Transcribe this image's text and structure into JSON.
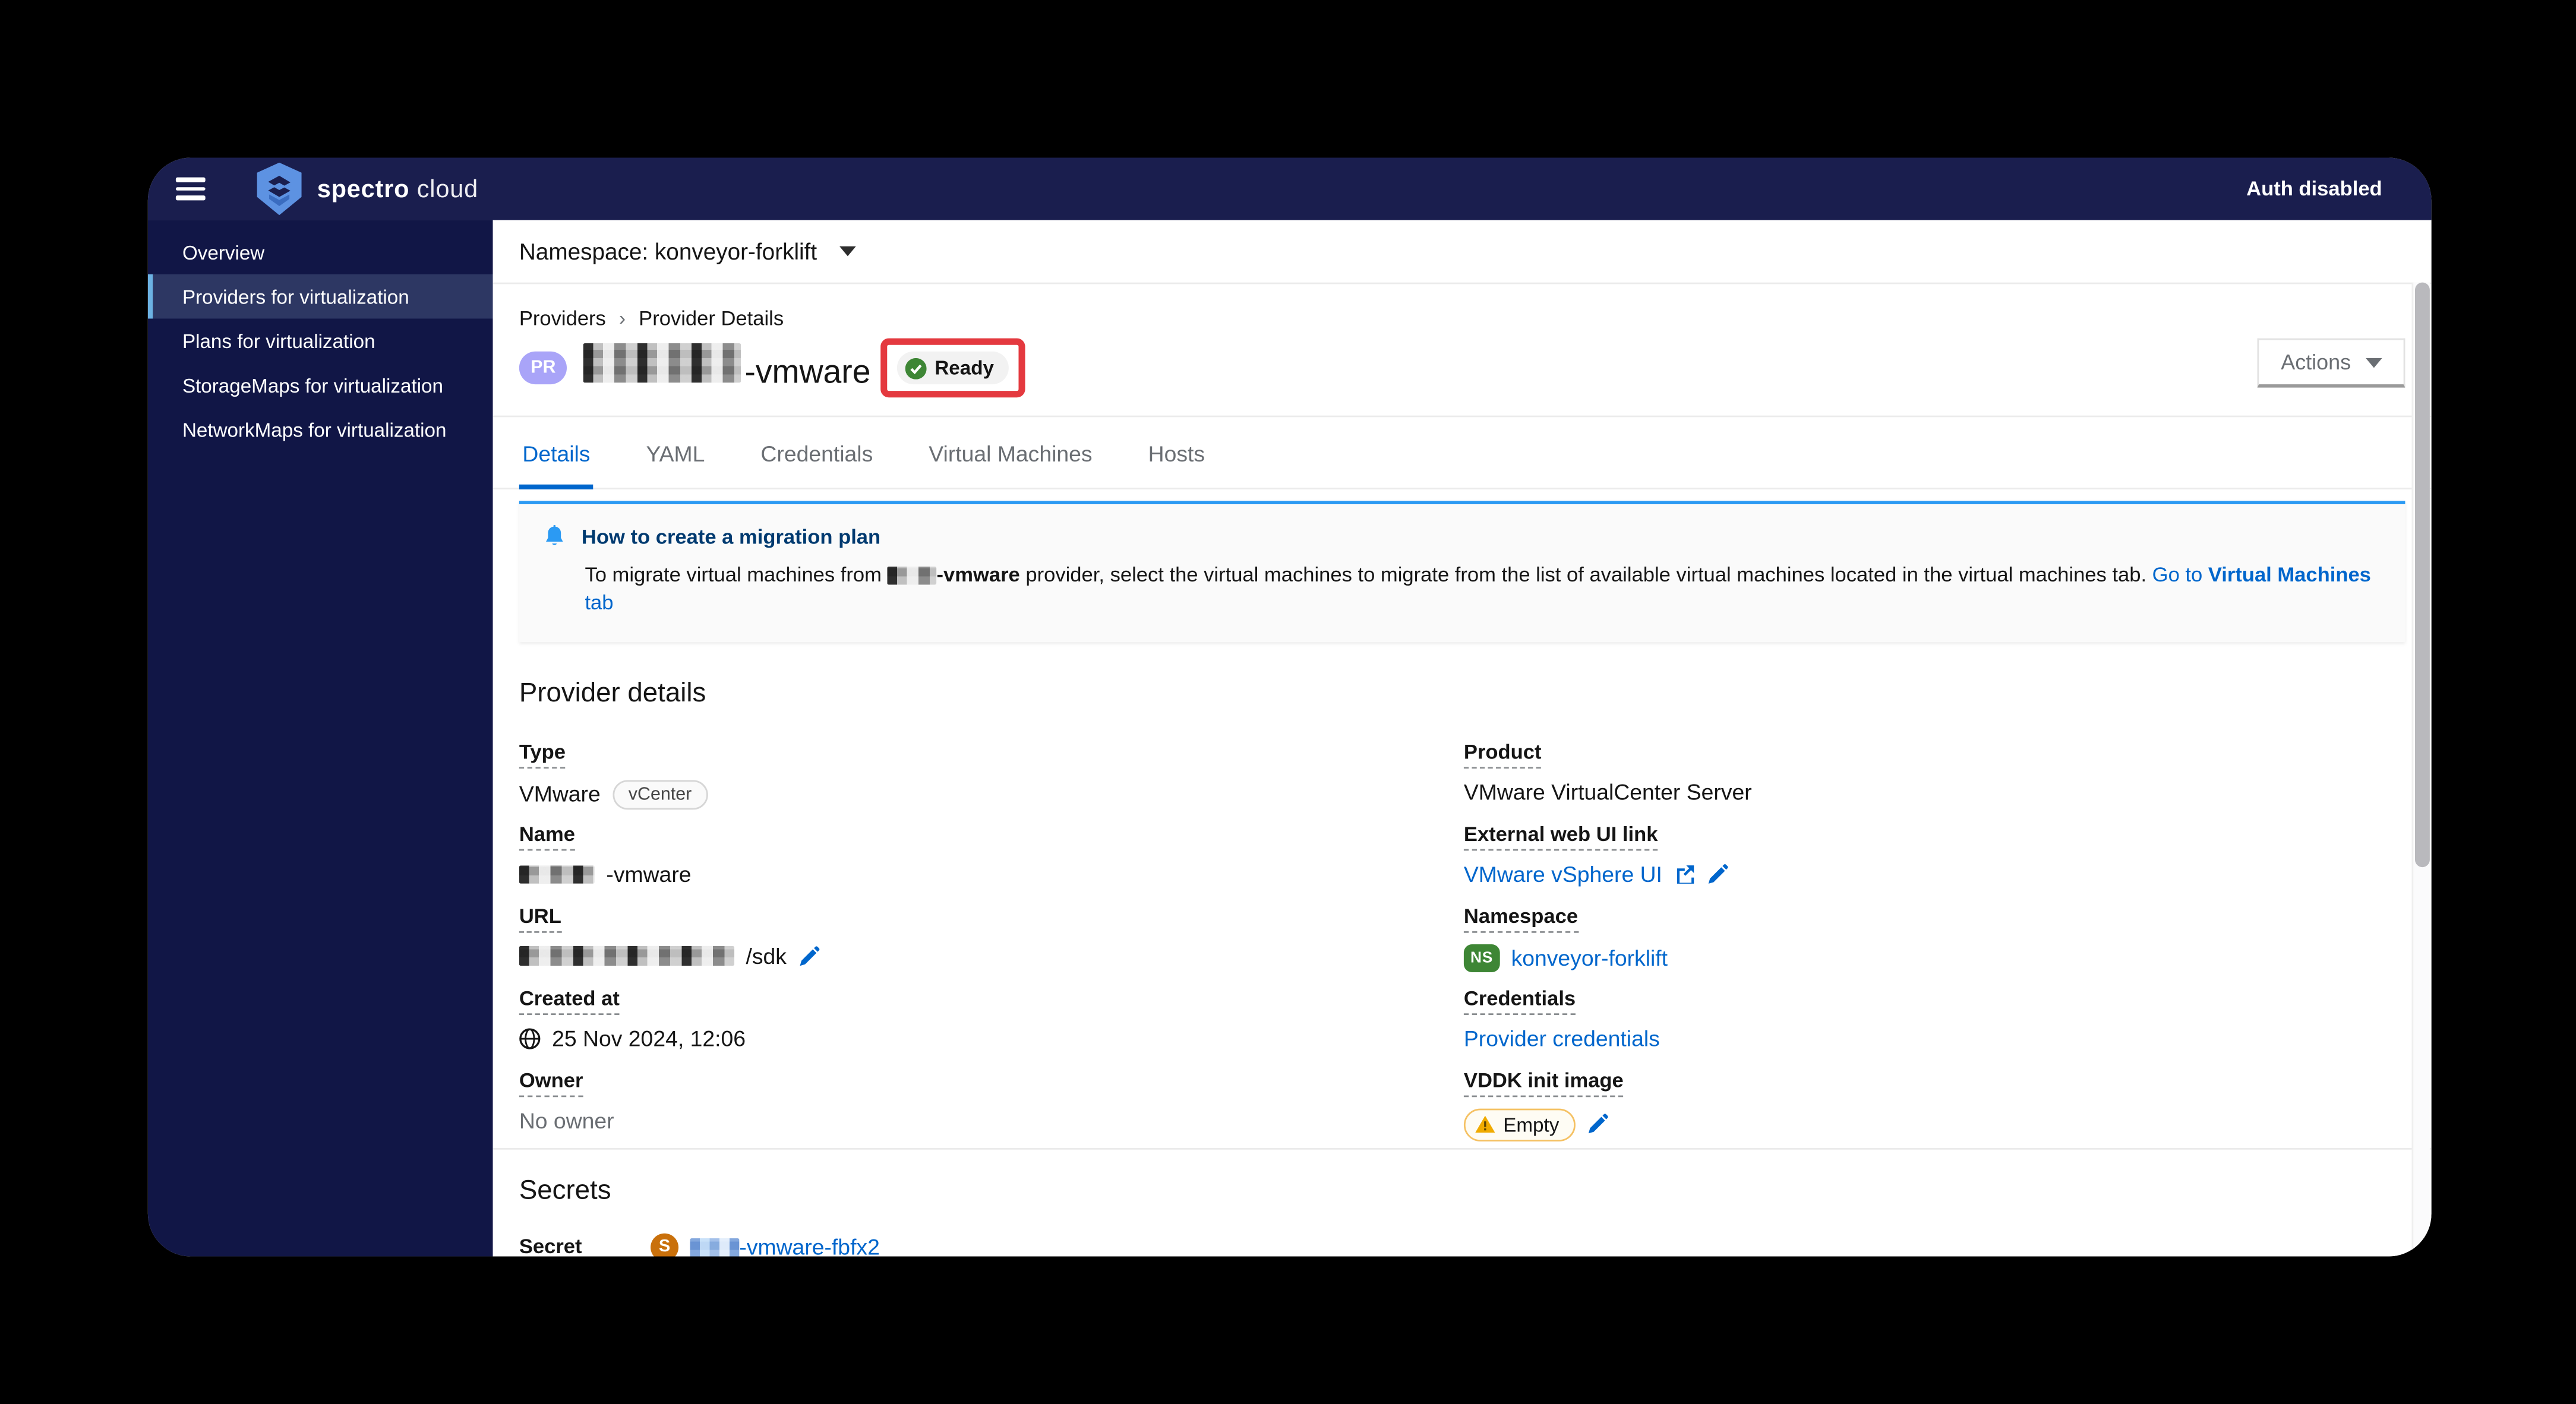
{
  "chrome": {
    "brand_word1": "spectro",
    "brand_word2": "cloud",
    "auth_status": "Auth disabled"
  },
  "sidebar": {
    "items": [
      {
        "label": "Overview",
        "active": false
      },
      {
        "label": "Providers for virtualization",
        "active": true
      },
      {
        "label": "Plans for virtualization",
        "active": false
      },
      {
        "label": "StorageMaps for virtualization",
        "active": false
      },
      {
        "label": "NetworkMaps for virtualization",
        "active": false
      }
    ]
  },
  "ns_bar": {
    "label": "Namespace: konveyor-forklift"
  },
  "breadcrumb": {
    "items": [
      "Providers",
      "Provider Details"
    ]
  },
  "header": {
    "entity_badge": "PR",
    "entity_name_suffix": "-vmware",
    "status": "Ready",
    "actions_label": "Actions"
  },
  "tabs": [
    {
      "label": "Details",
      "active": true
    },
    {
      "label": "YAML",
      "active": false
    },
    {
      "label": "Credentials",
      "active": false
    },
    {
      "label": "Virtual Machines",
      "active": false
    },
    {
      "label": "Hosts",
      "active": false
    }
  ],
  "banner": {
    "title": "How to create a migration plan",
    "body_prefix": "To migrate virtual machines from ",
    "body_bold": "-vmware",
    "body_rest": " provider, select the virtual machines to migrate from the list of available virtual machines located in the virtual machines tab. ",
    "link_prefix": "Go to ",
    "link_bold": "Virtual Machines",
    "link_suffix": " tab"
  },
  "provider_details": {
    "heading": "Provider details",
    "type": {
      "label": "Type",
      "value": "VMware",
      "badge": "vCenter"
    },
    "name": {
      "label": "Name",
      "value_suffix": "-vmware"
    },
    "url": {
      "label": "URL",
      "value_suffix": "/sdk"
    },
    "created_at": {
      "label": "Created at",
      "value": "25 Nov 2024, 12:06"
    },
    "owner": {
      "label": "Owner",
      "value": "No owner"
    },
    "product": {
      "label": "Product",
      "value": "VMware VirtualCenter Server"
    },
    "external_web_ui": {
      "label": "External web UI link",
      "link": "VMware vSphere UI"
    },
    "namespace": {
      "label": "Namespace",
      "badge": "NS",
      "link": "konveyor-forklift"
    },
    "credentials": {
      "label": "Credentials",
      "link": "Provider credentials"
    },
    "vddk": {
      "label": "VDDK init image",
      "badge": "Empty"
    }
  },
  "secrets": {
    "heading": "Secrets",
    "row_label": "Secret",
    "badge": "S",
    "link_suffix": "-vmware-fbfx2"
  },
  "colors": {
    "header_bg": "#1a1e4e",
    "sidebar_bg": "#111646",
    "sidebar_active_bg": "#2d3763",
    "sidebar_active_border": "#6cb2e3",
    "link_blue": "#0066cc",
    "banner_border_blue": "#2b9af3",
    "success_green": "#3e8635",
    "warning_gold": "#f0ab00",
    "secret_orange": "#c9700b",
    "annotation_red": "#e4393f",
    "pr_badge_purple": "#a9a4f8"
  }
}
